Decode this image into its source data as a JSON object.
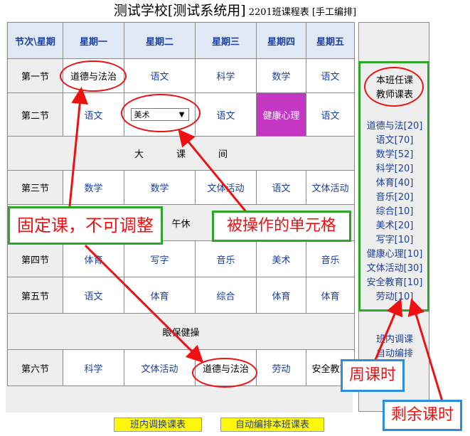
{
  "title": {
    "main": "测试学校[测试系统用]",
    "sub": "2201班课程表 [手工编排]"
  },
  "header": [
    "节次\\星期",
    "星期一",
    "星期二",
    "星期三",
    "星期四",
    "星期五"
  ],
  "rows": [
    {
      "period": "第一节",
      "cells": [
        "道德与法治",
        "语文",
        "科学",
        "数学",
        "语文"
      ]
    },
    {
      "period": "第二节",
      "cells": [
        "语文",
        "美术",
        "语文",
        "健康心理",
        "语文"
      ]
    },
    {
      "break_label": "大课间",
      "break_chars": [
        "大",
        "课",
        "间"
      ]
    },
    {
      "period": "第三节",
      "cells": [
        "数学",
        "数学",
        "文体活动",
        "语文",
        "文体活动"
      ]
    },
    {
      "break_label": "午休"
    },
    {
      "period": "第四节",
      "cells": [
        "体育",
        "写字",
        "音乐",
        "美术",
        "音乐"
      ]
    },
    {
      "period": "第五节",
      "cells": [
        "语文",
        "体育",
        "综合",
        "体育",
        "体育"
      ]
    },
    {
      "break_label": "眼保健操"
    },
    {
      "period": "第六节",
      "cells": [
        "科学",
        "文体活动",
        "道德与法治",
        "劳动",
        "安全教育"
      ]
    }
  ],
  "select_value": "美术",
  "side_panel": {
    "title_lines": [
      "本班任课",
      "教师课表"
    ],
    "remaining": [
      "道德与法[20]",
      "语文[70]",
      "数学[52]",
      "科学[20]",
      "体育[40]",
      "音乐[20]",
      "综合[10]",
      "美术[20]",
      "写字[10]",
      "健康心理[10]",
      "文体活动[30]",
      "安全教育[10]",
      "劳动[10]"
    ],
    "link_swap": "班内调课",
    "link_auto": "自动编排"
  },
  "buttons": {
    "swap": "班内调换课表",
    "auto": "自动编排本班课表"
  },
  "annotations": {
    "fixed": "固定课，不可调整",
    "operated": "被操作的单元格",
    "weekly": "周课时",
    "remaining": "剩余课时"
  },
  "colors": {
    "link": "#1a3fa0",
    "health_cell": "#c337c3",
    "annotation_red": "#ee1111",
    "annotation_green": "#2fa52a",
    "annotation_blue": "#2b8fe0",
    "button": "#fff60a"
  }
}
